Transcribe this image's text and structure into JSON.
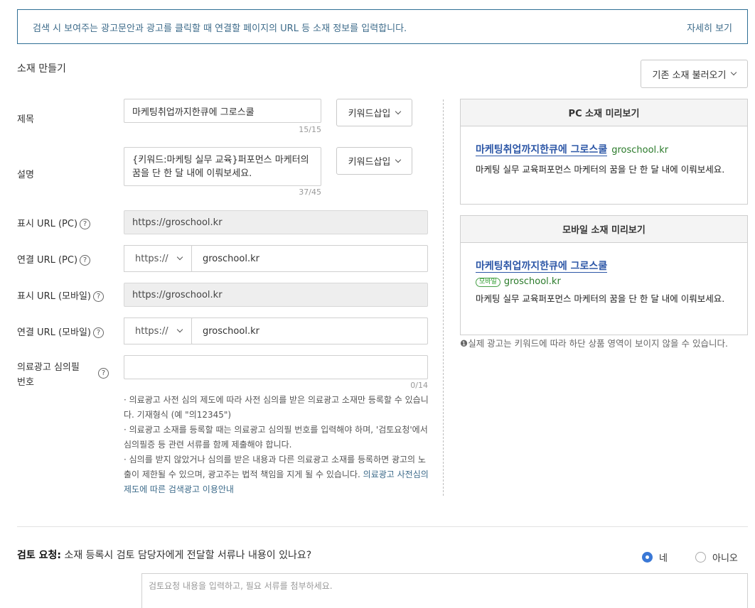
{
  "notice": {
    "text": "검색 시 보여주는 광고문안과 광고를 클릭할 때 연결할 페이지의 URL 등 소재 정보를 입력합니다.",
    "link": "자세히 보기"
  },
  "section_title": "소재 만들기",
  "load_button": "기존 소재 불러오기",
  "form": {
    "title": {
      "label": "제목",
      "value": "마케팅취업까지한큐에 그로스쿨",
      "counter": "15/15",
      "kw_button": "키워드삽입"
    },
    "description": {
      "label": "설명",
      "value": "{키워드:마케팅 실무 교육}퍼포먼스 마케터의 꿈을 단 한 달 내에 이뤄보세요.",
      "counter": "37/45",
      "kw_button": "키워드삽입"
    },
    "display_url_pc": {
      "label": "표시 URL (PC)",
      "value": "https://groschool.kr"
    },
    "link_url_pc": {
      "label": "연결 URL (PC)",
      "protocol": "https://",
      "value": "groschool.kr"
    },
    "display_url_mobile": {
      "label": "표시 URL (모바일)",
      "value": "https://groschool.kr"
    },
    "link_url_mobile": {
      "label": "연결 URL (모바일)",
      "protocol": "https://",
      "value": "groschool.kr"
    },
    "medical": {
      "label_line1": "의료광고 심의필",
      "label_line2": "번호",
      "value": "",
      "counter": "0/14"
    },
    "help_glyph": "?"
  },
  "notes": [
    "·  의료광고 사전 심의 제도에 따라 사전 심의를 받은 의료광고 소재만 등록할 수 있습니다. 기재형식 (예 \"의12345\")",
    "·  의료광고 소재를 등록할 때는 의료광고 심의필 번호를 입력해야 하며, '검토요청'에서 심의필증 등 관련 서류를 함께 제출해야 합니다.",
    "·  심의를 받지 않았거나 심의를 받은 내용과 다른 의료광고 소재를 등록하면 광고의 노출이 제한될 수 있으며, 광고주는 법적 책임을 지게 될 수 있습니다."
  ],
  "notes_link": "의료광고 사전심의 제도에 따른 검색광고 이용안내",
  "preview_pc": {
    "header": "PC 소재 미리보기",
    "title": "마케팅취업까지한큐에 그로스쿨",
    "url": "groschool.kr",
    "desc": "마케팅 실무 교육퍼포먼스 마케터의 꿈을 단 한 달 내에 이뤄보세요."
  },
  "preview_mobile": {
    "header": "모바일 소재 미리보기",
    "title": "마케팅취업까지한큐에 그로스쿨",
    "badge": "모바일",
    "url": "groschool.kr",
    "desc": "마케팅 실무 교육퍼포먼스 마케터의 꿈을 단 한 달 내에 이뤄보세요."
  },
  "caution": "❶실제 광고는 키워드에 따라 하단 상품 영역이 보이지 않을 수 있습니다.",
  "review": {
    "label_bold": "검토 요청:",
    "question": " 소재 등록시 검토 담당자에게 전달할 서류나 내용이 있나요?",
    "yes": "네",
    "no": "아니오",
    "selected": "yes",
    "placeholder": "검토요청 내용을 입력하고, 필요 서류를 첨부하세요."
  },
  "colors": {
    "accent": "#2f6f95",
    "link_blue": "#2d57a7",
    "url_green": "#2a7a2a",
    "radio_blue": "#3a78d6"
  }
}
